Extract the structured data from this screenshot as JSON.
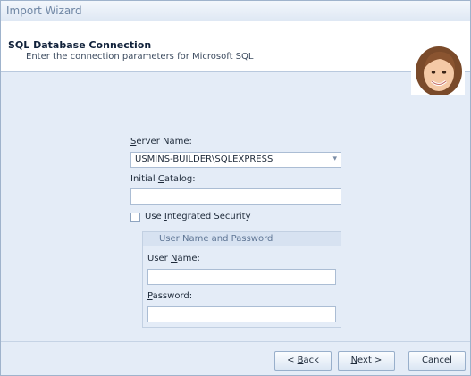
{
  "window": {
    "title": "Import Wizard"
  },
  "header": {
    "title": "SQL Database Connection",
    "subtitle": "Enter the connection parameters for Microsoft SQL"
  },
  "form": {
    "server_name": {
      "label_mnemonic": "S",
      "label_rest": "erver Name:",
      "value": "USMINS-BUILDER\\SQLEXPRESS"
    },
    "initial_catalog": {
      "label_prefix": "Initial ",
      "label_mnemonic": "C",
      "label_rest": "atalog:",
      "value": ""
    },
    "integrated_security": {
      "label_prefix": "Use ",
      "label_mnemonic": "I",
      "label_rest": "ntegrated Security",
      "checked": false
    },
    "credentials_group": {
      "title": "User Name and Password",
      "user_name": {
        "label_prefix": "User ",
        "label_mnemonic": "N",
        "label_rest": "ame:",
        "value": ""
      },
      "password": {
        "label_mnemonic": "P",
        "label_rest": "assword:",
        "value": ""
      }
    }
  },
  "buttons": {
    "back": {
      "prefix": "< ",
      "mnemonic": "B",
      "rest": "ack"
    },
    "next": {
      "mnemonic": "N",
      "rest": "ext >"
    },
    "cancel": {
      "label": "Cancel"
    }
  },
  "icons": {
    "avatar": "woman-portrait",
    "dropdown": "dropdown-arrow-icon"
  },
  "colors": {
    "accent": "#9fb3cc",
    "background": "#e4ecf7"
  }
}
